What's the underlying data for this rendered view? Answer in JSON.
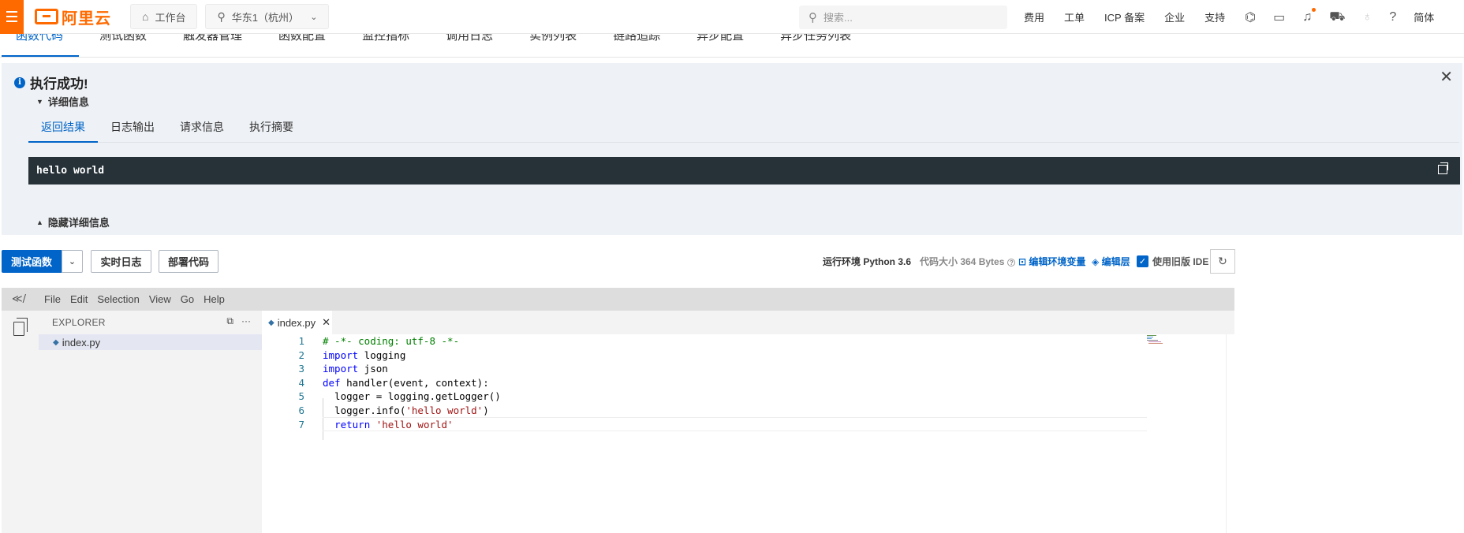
{
  "topbar": {
    "logo_text": "阿里云",
    "workbench": "工作台",
    "region": "华东1（杭州）",
    "search_placeholder": "搜索...",
    "links": [
      "费用",
      "工单",
      "ICP 备案",
      "企业",
      "支持"
    ],
    "lang": "简体",
    "brand_color": "#ff6a00"
  },
  "subtabs": [
    "函数代码",
    "测试函数",
    "触发器管理",
    "函数配置",
    "监控指标",
    "调用日志",
    "实例列表",
    "链路追踪",
    "异步配置",
    "异步任务列表"
  ],
  "result": {
    "title": "执行成功!",
    "detail_toggle": "详细信息",
    "tabs": [
      "返回结果",
      "日志输出",
      "请求信息",
      "执行摘要"
    ],
    "output": "hello world",
    "hide_toggle": "隐藏详细信息"
  },
  "actions": {
    "test_button": "测试函数",
    "realtime_log": "实时日志",
    "deploy": "部署代码",
    "runtime": "运行环境 Python 3.6",
    "code_size": "代码大小 364 Bytes",
    "edit_env": "编辑环境变量",
    "edit_layer": "编辑层",
    "legacy_ide": "使用旧版 IDE",
    "accent_color": "#0064c8"
  },
  "ide": {
    "menus": [
      "File",
      "Edit",
      "Selection",
      "View",
      "Go",
      "Help"
    ],
    "explorer_title": "EXPLORER",
    "file_name": "index.py",
    "tab_name": "index.py",
    "line_numbers": [
      "1",
      "2",
      "3",
      "4",
      "5",
      "6",
      "7"
    ],
    "code": {
      "l1_comment": "# -*- coding: utf-8 -*-",
      "l2_kw": "import",
      "l2_rest": " logging",
      "l3_kw": "import",
      "l3_rest": " json",
      "l4_kw": "def",
      "l4_rest": " handler(event, context):",
      "l5": "  logger = logging.getLogger()",
      "l6_pre": "  logger.info(",
      "l6_str": "'hello world'",
      "l6_post": ")",
      "l7_kw": "return",
      "l7_str": "'hello world'"
    }
  }
}
